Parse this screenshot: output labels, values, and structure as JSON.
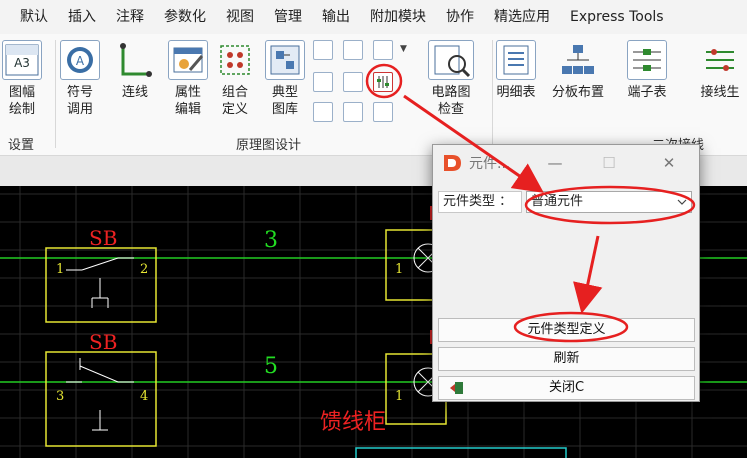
{
  "menu": [
    "默认",
    "插入",
    "注释",
    "参数化",
    "视图",
    "管理",
    "输出",
    "附加模块",
    "协作",
    "精选应用",
    "Express Tools"
  ],
  "ribbon": {
    "tools": [
      {
        "label": "图幅\n绘制",
        "icon": "drawing-frame-icon",
        "badge": "A3"
      },
      {
        "label": "符号\n调用",
        "icon": "symbol-call-icon"
      },
      {
        "label": "连线",
        "icon": "connect-line-icon"
      },
      {
        "label": "属性\n编辑",
        "icon": "property-edit-icon"
      },
      {
        "label": "组合\n定义",
        "icon": "group-define-icon"
      },
      {
        "label": "典型\n图库",
        "icon": "typical-library-icon"
      },
      {
        "label": "电路图\n检查",
        "icon": "circuit-check-icon"
      },
      {
        "label": "明细表",
        "icon": "bom-table-icon"
      },
      {
        "label": "分板布置",
        "icon": "panel-layout-icon"
      },
      {
        "label": "端子表",
        "icon": "terminal-table-icon"
      },
      {
        "label": "接线生",
        "icon": "wiring-gen-icon"
      }
    ],
    "groups": {
      "settings": "设置",
      "schematic": "原理图设计",
      "secondary": "二次接线"
    }
  },
  "canvas": {
    "sb1": "SB",
    "sb2": "SB",
    "num3": "3",
    "num5": "5",
    "pin1a": "1",
    "pin2": "2",
    "pin3": "3",
    "pin4": "4",
    "lamp_pin1": "1",
    "lamp_pin2": "1",
    "feeder": "馈线柜"
  },
  "dialog": {
    "title": "元件...",
    "minimize": "—",
    "maximize": "☐",
    "close": "✕",
    "type_label": "元件类型 ：",
    "type_value": "普通元件",
    "define_button": "元件类型定义",
    "refresh_button": "刷新",
    "close_button": "关闭C"
  }
}
